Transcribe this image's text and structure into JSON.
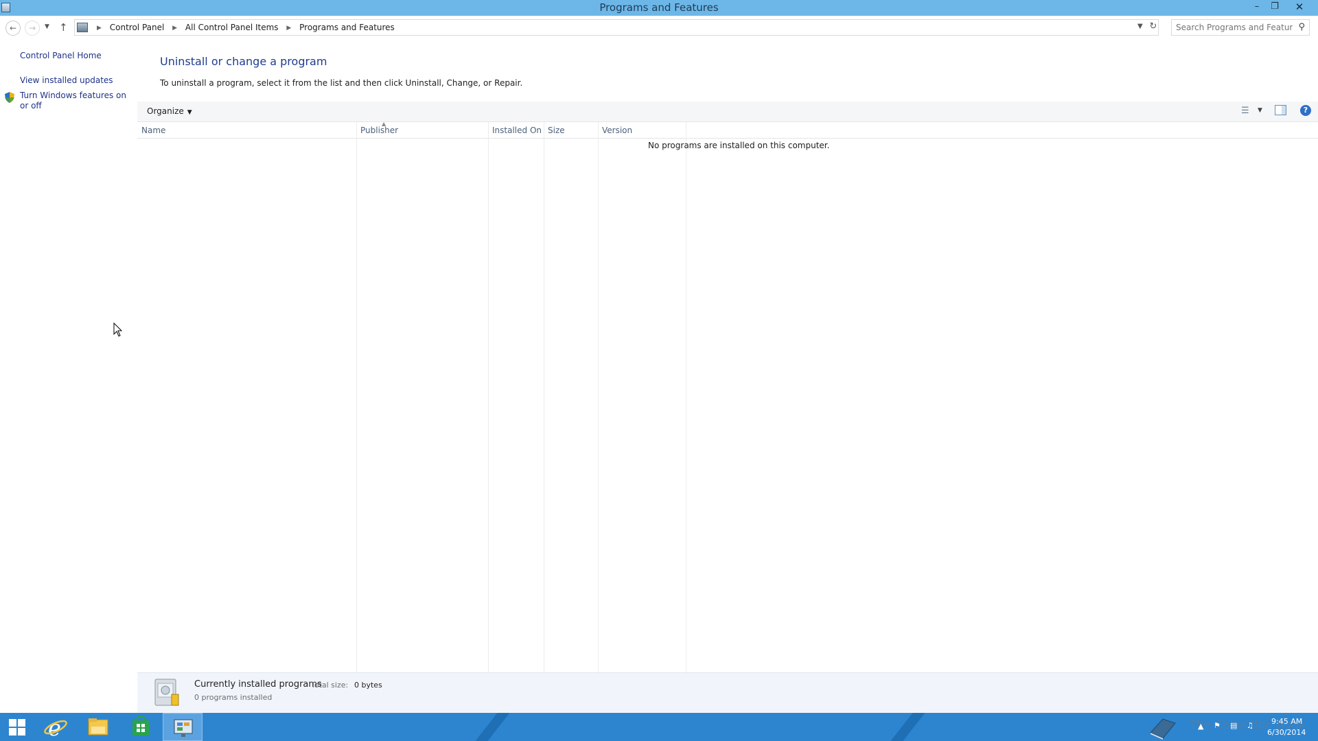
{
  "window": {
    "title": "Programs and Features"
  },
  "address": {
    "crumbs": [
      "Control Panel",
      "All Control Panel Items",
      "Programs and Features"
    ]
  },
  "search": {
    "placeholder": "Search Programs and Features"
  },
  "sidebar": {
    "home": "Control Panel Home",
    "updates": "View installed updates",
    "features": "Turn Windows features on or off"
  },
  "main": {
    "heading": "Uninstall or change a program",
    "instructions": "To uninstall a program, select it from the list and then click Uninstall, Change, or Repair.",
    "organize_label": "Organize",
    "columns": [
      "Name",
      "Publisher",
      "Installed On",
      "Size",
      "Version"
    ],
    "empty_message": "No programs are installed on this computer."
  },
  "details": {
    "label": "Currently installed programs",
    "size_label": "Total size:",
    "size_value": "0 bytes",
    "count": "0 programs installed"
  },
  "taskbar": {
    "time": "9:45 AM",
    "date": "6/30/2014",
    "watermark": "The Collection Book"
  },
  "colors": {
    "titlebar": "#6cb7e7",
    "taskbar": "#2d85d0",
    "link": "#1e3287"
  }
}
